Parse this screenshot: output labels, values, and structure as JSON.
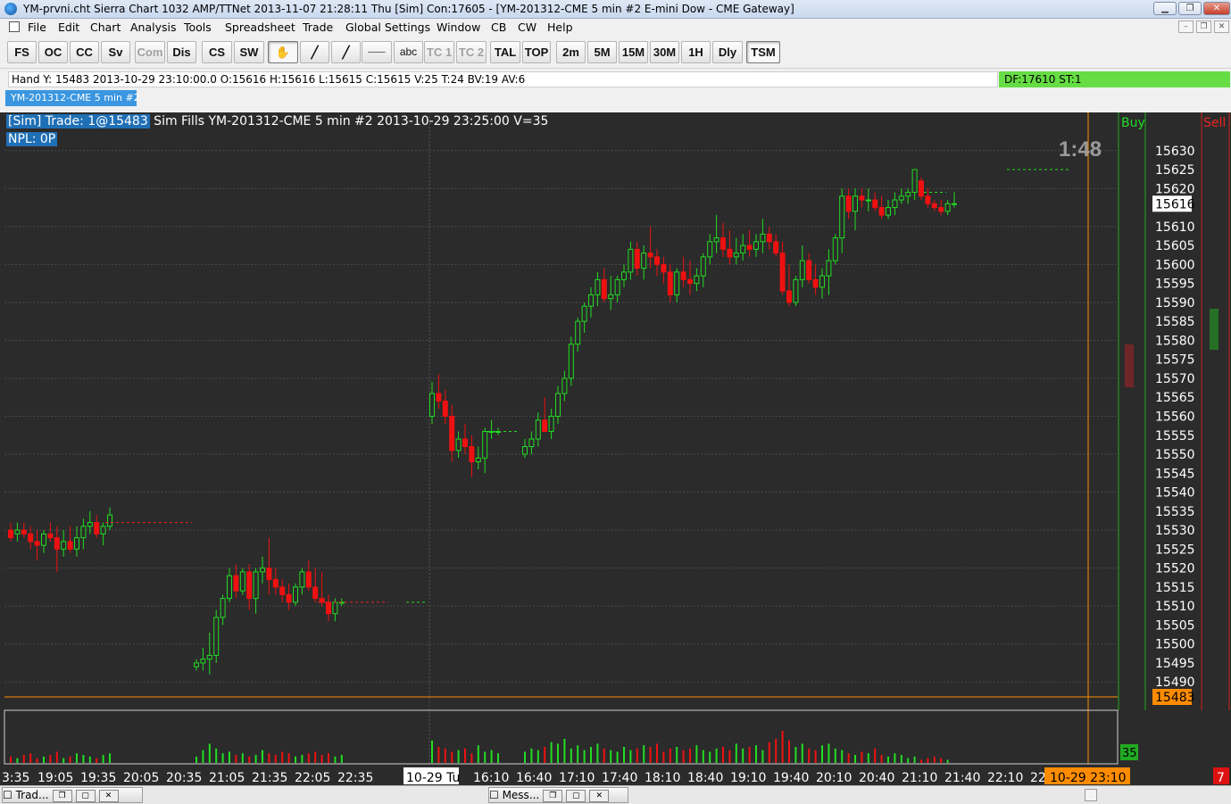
{
  "window": {
    "title": "YM-prvni.cht   Sierra Chart 1032 AMP/TTNet 2013-11-07  21:28:11 Thu [Sim]   Con:17605 - [YM-201312-CME  5 min   #2  E-mini Dow - CME Gateway]",
    "min_label": "▁",
    "restore_label": "❐",
    "close_label": "✕"
  },
  "menu": {
    "items": [
      "File",
      "Edit",
      "Chart",
      "Analysis",
      "Tools",
      "Spreadsheet",
      "Trade",
      "Global Settings",
      "Window",
      "CB",
      "CW",
      "Help"
    ],
    "mdi_min": "–",
    "mdi_restore": "❐",
    "mdi_close": "✕"
  },
  "toolbar": {
    "buttons": [
      "FS",
      "OC",
      "CC",
      "Sv",
      "Com",
      "Dis",
      "CS",
      "SW",
      "✋",
      "╱",
      "╱",
      "───",
      "abc",
      "TC 1",
      "TC 2",
      "TAL",
      "TOP",
      "2m",
      "5M",
      "15M",
      "30M",
      "1H",
      "Dly",
      "TSM"
    ],
    "icons": [
      "",
      "",
      "",
      "",
      "",
      "",
      "",
      "",
      "hand-cursor-icon",
      "line-tool-icon",
      "ray-tool-icon",
      "horizontal-line-icon",
      "",
      "",
      "",
      "",
      "",
      "",
      "",
      "",
      "",
      "",
      "",
      ""
    ]
  },
  "infobar": {
    "text": "Hand Y: 15483  2013-10-29  23:10:00.0  O:15616  H:15616  L:15615  C:15615  V:25  T:24  BV:19  AV:6",
    "df": "DF:17610   ST:1"
  },
  "chart_tab": "YM-201312-CME  5 min   #2",
  "chart": {
    "header_hl": "[Sim]  Trade: 1@15483",
    "header_rest": " Sim Fills  YM-201312-CME  5 min   #2 2013-10-29 23:25:00 V=35",
    "npl": "NPL: 0P",
    "timer": "1:48",
    "buy_label": "Buy",
    "sell_label": "Sell",
    "current_price": "15616",
    "trade_price": "15483",
    "volume_label": "35",
    "bar_count_label": "7",
    "date_label": "10-29 Tu",
    "cursor_time": "10-29  23:10"
  },
  "chart_data": {
    "type": "candlestick",
    "instrument": "YM-201312-CME",
    "interval": "5 min",
    "ylim": [
      15483,
      15633
    ],
    "y_ticks": [
      15630,
      15625,
      15620,
      15610,
      15605,
      15600,
      15595,
      15590,
      15585,
      15580,
      15575,
      15570,
      15565,
      15560,
      15555,
      15550,
      15545,
      15540,
      15535,
      15530,
      15525,
      15520,
      15515,
      15510,
      15505,
      15500,
      15495,
      15490
    ],
    "x_ticks": [
      "3:35",
      "19:05",
      "19:35",
      "20:05",
      "20:35",
      "21:05",
      "21:35",
      "22:05",
      "22:35",
      "16:10",
      "16:40",
      "17:10",
      "17:40",
      "18:10",
      "18:40",
      "19:10",
      "19:40",
      "20:10",
      "20:40",
      "21:10",
      "21:40",
      "22:10",
      "22"
    ],
    "candles": [
      [
        15530,
        15532,
        15527,
        15528
      ],
      [
        15529,
        15532,
        15527,
        15530
      ],
      [
        15530,
        15532,
        15528,
        15529
      ],
      [
        15529,
        15531,
        15525,
        15527
      ],
      [
        15527,
        15530,
        15522,
        15526
      ],
      [
        15526,
        15530,
        15524,
        15529
      ],
      [
        15529,
        15532,
        15527,
        15528
      ],
      [
        15528,
        15531,
        15519,
        15525
      ],
      [
        15525,
        15530,
        15523,
        15527
      ],
      [
        15527,
        15531,
        15524,
        15525
      ],
      [
        15525,
        15531,
        15523,
        15528
      ],
      [
        15528,
        15533,
        15525,
        15531
      ],
      [
        15531,
        15535,
        15529,
        15532
      ],
      [
        15532,
        15534,
        15528,
        15529
      ],
      [
        15529,
        15532,
        15526,
        15531
      ],
      [
        15531,
        15536,
        15530,
        15534
      ],
      [
        15494,
        15496,
        15493,
        15495
      ],
      [
        15495,
        15499,
        15493,
        15496
      ],
      [
        15496,
        15503,
        15492,
        15497
      ],
      [
        15497,
        15509,
        15495,
        15507
      ],
      [
        15507,
        15513,
        15505,
        15512
      ],
      [
        15512,
        15520,
        15511,
        15518
      ],
      [
        15518,
        15521,
        15512,
        15514
      ],
      [
        15514,
        15520,
        15513,
        15519
      ],
      [
        15519,
        15521,
        15509,
        15512
      ],
      [
        15512,
        15520,
        15508,
        15519
      ],
      [
        15519,
        15523,
        15516,
        15520
      ],
      [
        15520,
        15528,
        15513,
        15517
      ],
      [
        15517,
        15520,
        15513,
        15515
      ],
      [
        15515,
        15517,
        15511,
        15513
      ],
      [
        15513,
        15516,
        15509,
        15511
      ],
      [
        15511,
        15516,
        15510,
        15515
      ],
      [
        15515,
        15520,
        15513,
        15519
      ],
      [
        15519,
        15522,
        15514,
        15515
      ],
      [
        15515,
        15520,
        15511,
        15512
      ],
      [
        15512,
        15519,
        15510,
        15511
      ],
      [
        15511,
        15513,
        15506,
        15508
      ],
      [
        15508,
        15512,
        15506,
        15511
      ],
      [
        15511,
        15512,
        15510,
        15511
      ],
      [
        15560,
        15569,
        15558,
        15566
      ],
      [
        15566,
        15571,
        15562,
        15564
      ],
      [
        15564,
        15567,
        15558,
        15560
      ],
      [
        15560,
        15563,
        15548,
        15551
      ],
      [
        15551,
        15556,
        15549,
        15554
      ],
      [
        15554,
        15558,
        15550,
        15552
      ],
      [
        15552,
        15555,
        15544,
        15548
      ],
      [
        15548,
        15552,
        15546,
        15549
      ],
      [
        15549,
        15557,
        15545,
        15556
      ],
      [
        15556,
        15559,
        15554,
        15556
      ],
      [
        15556,
        15557,
        15555,
        15556
      ],
      [
        15550,
        15554,
        15549,
        15552
      ],
      [
        15552,
        15556,
        15550,
        15554
      ],
      [
        15554,
        15561,
        15552,
        15559
      ],
      [
        15559,
        15565,
        15557,
        15556
      ],
      [
        15556,
        15562,
        15554,
        15560
      ],
      [
        15560,
        15568,
        15558,
        15566
      ],
      [
        15566,
        15572,
        15564,
        15570
      ],
      [
        15570,
        15581,
        15568,
        15579
      ],
      [
        15579,
        15586,
        15577,
        15585
      ],
      [
        15585,
        15590,
        15582,
        15589
      ],
      [
        15589,
        15594,
        15586,
        15592
      ],
      [
        15592,
        15598,
        15589,
        15596
      ],
      [
        15596,
        15599,
        15590,
        15591
      ],
      [
        15591,
        15597,
        15588,
        15592
      ],
      [
        15592,
        15597,
        15590,
        15596
      ],
      [
        15596,
        15600,
        15594,
        15598
      ],
      [
        15598,
        15606,
        15596,
        15604
      ],
      [
        15604,
        15606,
        15597,
        15599
      ],
      [
        15599,
        15605,
        15596,
        15603
      ],
      [
        15603,
        15610,
        15599,
        15602
      ],
      [
        15602,
        15604,
        15597,
        15600
      ],
      [
        15600,
        15602,
        15595,
        15598
      ],
      [
        15598,
        15600,
        15590,
        15592
      ],
      [
        15592,
        15599,
        15590,
        15598
      ],
      [
        15598,
        15602,
        15594,
        15596
      ],
      [
        15596,
        15601,
        15592,
        15595
      ],
      [
        15595,
        15599,
        15593,
        15597
      ],
      [
        15597,
        15603,
        15594,
        15602
      ],
      [
        15602,
        15608,
        15600,
        15606
      ],
      [
        15606,
        15613,
        15603,
        15607
      ],
      [
        15607,
        15611,
        15602,
        15604
      ],
      [
        15604,
        15609,
        15600,
        15602
      ],
      [
        15602,
        15607,
        15600,
        15603
      ],
      [
        15603,
        15608,
        15601,
        15605
      ],
      [
        15605,
        15609,
        15602,
        15604
      ],
      [
        15604,
        15608,
        15602,
        15606
      ],
      [
        15606,
        15612,
        15603,
        15608
      ],
      [
        15608,
        15610,
        15604,
        15606
      ],
      [
        15606,
        15608,
        15602,
        15603
      ],
      [
        15603,
        15606,
        15592,
        15593
      ],
      [
        15593,
        15600,
        15589,
        15590
      ],
      [
        15590,
        15597,
        15589,
        15596
      ],
      [
        15596,
        15605,
        15594,
        15601
      ],
      [
        15601,
        15603,
        15595,
        15596
      ],
      [
        15596,
        15600,
        15592,
        15594
      ],
      [
        15594,
        15599,
        15591,
        15597
      ],
      [
        15597,
        15604,
        15592,
        15601
      ],
      [
        15601,
        15608,
        15600,
        15607
      ],
      [
        15607,
        15620,
        15603,
        15618
      ],
      [
        15618,
        15620,
        15612,
        15614
      ],
      [
        15614,
        15620,
        15609,
        15618
      ],
      [
        15618,
        15620,
        15615,
        15617
      ],
      [
        15617,
        15620,
        15614,
        15617
      ],
      [
        15617,
        15619,
        15614,
        15615
      ],
      [
        15615,
        15618,
        15612,
        15613
      ],
      [
        15613,
        15617,
        15612,
        15615
      ],
      [
        15615,
        15619,
        15613,
        15617
      ],
      [
        15617,
        15620,
        15616,
        15618
      ],
      [
        15618,
        15620,
        15616,
        15619
      ],
      [
        15619,
        15625,
        15617,
        15625
      ],
      [
        15622,
        15623,
        15617,
        15618
      ],
      [
        15618,
        15620,
        15615,
        15616
      ],
      [
        15616,
        15617,
        15614,
        15615
      ],
      [
        15615,
        15617,
        15613,
        15614
      ],
      [
        15614,
        15617,
        15613,
        15616
      ],
      [
        15616,
        15619,
        15615,
        15616
      ]
    ],
    "volumes": [
      4,
      3,
      5,
      6,
      3,
      4,
      5,
      7,
      3,
      4,
      6,
      5,
      4,
      3,
      5,
      6,
      4,
      8,
      12,
      9,
      6,
      7,
      5,
      6,
      4,
      5,
      8,
      6,
      5,
      7,
      6,
      4,
      5,
      6,
      7,
      5,
      6,
      4,
      5,
      14,
      10,
      9,
      7,
      8,
      9,
      6,
      11,
      7,
      8,
      6,
      7,
      9,
      8,
      10,
      13,
      12,
      15,
      9,
      11,
      8,
      10,
      12,
      9,
      8,
      7,
      10,
      8,
      9,
      11,
      10,
      12,
      7,
      9,
      10,
      8,
      9,
      11,
      8,
      7,
      9,
      10,
      8,
      12,
      9,
      10,
      11,
      8,
      13,
      15,
      20,
      14,
      10,
      12,
      9,
      8,
      11,
      12,
      9,
      8,
      6,
      5,
      7,
      6,
      9,
      5,
      4,
      6,
      5,
      3,
      4,
      2,
      3,
      4,
      3,
      2
    ],
    "indicator_labels": [
      "Buy",
      "Sell"
    ],
    "volume_last": 35
  }
}
